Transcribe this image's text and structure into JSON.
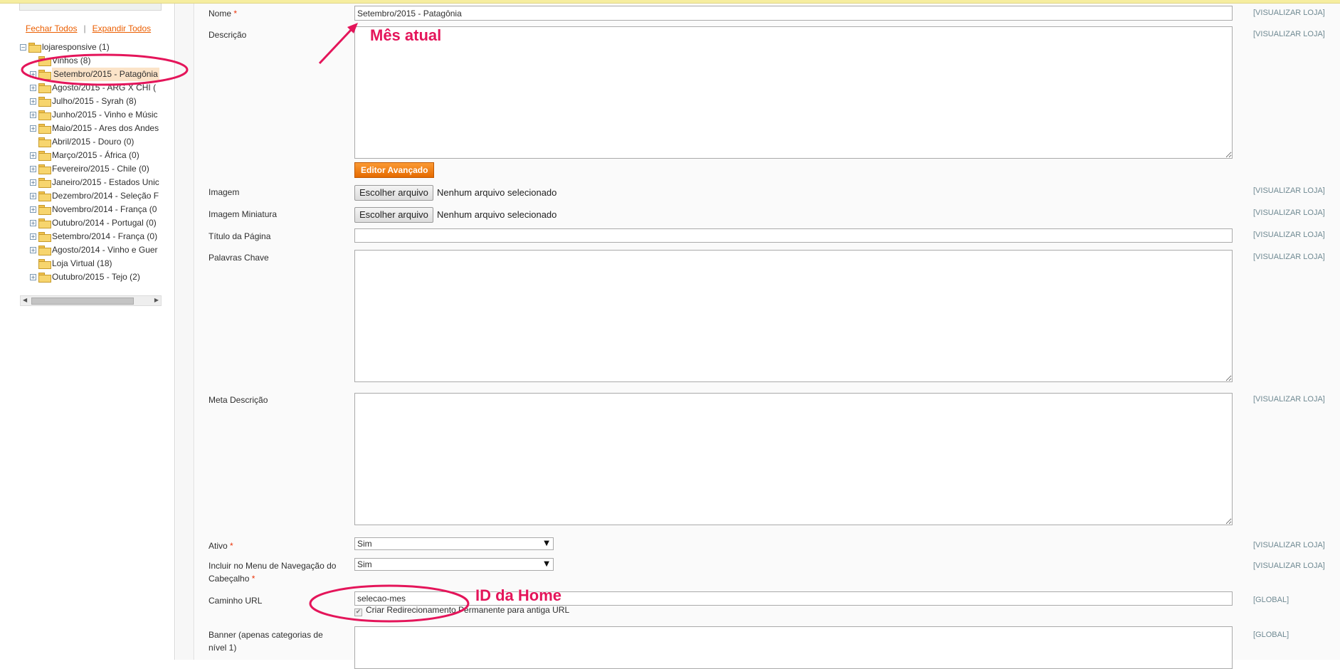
{
  "tree_links": {
    "collapse_all": "Fechar Todos",
    "separator": "|",
    "expand_all": "Expandir Todos"
  },
  "tree": [
    {
      "label": "lojaresponsive (1)",
      "level": 0,
      "toggle": "minus",
      "icon": "open-folder"
    },
    {
      "label": "Vinhos (8)",
      "level": 1,
      "toggle": "none",
      "icon": "folder"
    },
    {
      "label": "Setembro/2015 - Patagônia",
      "level": 1,
      "toggle": "plus",
      "icon": "folder",
      "selected": true
    },
    {
      "label": "Agosto/2015 - ARG X CHI (",
      "level": 1,
      "toggle": "plus",
      "icon": "folder"
    },
    {
      "label": "Julho/2015 - Syrah (8)",
      "level": 1,
      "toggle": "plus",
      "icon": "folder"
    },
    {
      "label": "Junho/2015 - Vinho e Músic",
      "level": 1,
      "toggle": "plus",
      "icon": "folder"
    },
    {
      "label": "Maio/2015 - Ares dos Andes",
      "level": 1,
      "toggle": "plus",
      "icon": "folder"
    },
    {
      "label": "Abril/2015 - Douro (0)",
      "level": 1,
      "toggle": "none",
      "icon": "folder"
    },
    {
      "label": "Março/2015 - África (0)",
      "level": 1,
      "toggle": "plus",
      "icon": "folder"
    },
    {
      "label": "Fevereiro/2015 - Chile (0)",
      "level": 1,
      "toggle": "plus",
      "icon": "folder"
    },
    {
      "label": "Janeiro/2015 - Estados Unic",
      "level": 1,
      "toggle": "plus",
      "icon": "folder"
    },
    {
      "label": "Dezembro/2014 - Seleção F",
      "level": 1,
      "toggle": "plus",
      "icon": "folder"
    },
    {
      "label": "Novembro/2014 - França (0",
      "level": 1,
      "toggle": "plus",
      "icon": "folder"
    },
    {
      "label": "Outubro/2014 - Portugal (0)",
      "level": 1,
      "toggle": "plus",
      "icon": "folder"
    },
    {
      "label": "Setembro/2014 - França (0)",
      "level": 1,
      "toggle": "plus",
      "icon": "folder"
    },
    {
      "label": "Agosto/2014 - Vinho e Guer",
      "level": 1,
      "toggle": "plus",
      "icon": "folder"
    },
    {
      "label": "Loja Virtual (18)",
      "level": 1,
      "toggle": "none",
      "icon": "folder"
    },
    {
      "label": "Outubro/2015 - Tejo (2)",
      "level": 1,
      "toggle": "plus",
      "icon": "folder"
    }
  ],
  "form": {
    "name": {
      "label": "Nome",
      "required": "*",
      "value": "Setembro/2015 - Patagônia",
      "scope": "[VISUALIZAR LOJA]"
    },
    "description": {
      "label": "Descrição",
      "value": "",
      "scope": "[VISUALIZAR LOJA]"
    },
    "editor_button": "Editor Avançado",
    "image": {
      "label": "Imagem",
      "button": "Escolher arquivo",
      "status": "Nenhum arquivo selecionado",
      "scope": "[VISUALIZAR LOJA]"
    },
    "thumbnail": {
      "label": "Imagem Miniatura",
      "button": "Escolher arquivo",
      "status": "Nenhum arquivo selecionado",
      "scope": "[VISUALIZAR LOJA]"
    },
    "page_title": {
      "label": "Título da Página",
      "value": "",
      "scope": "[VISUALIZAR LOJA]"
    },
    "keywords": {
      "label": "Palavras Chave",
      "value": "",
      "scope": "[VISUALIZAR LOJA]"
    },
    "meta_description": {
      "label": "Meta Descrição",
      "value": "",
      "scope": "[VISUALIZAR LOJA]"
    },
    "active": {
      "label": "Ativo",
      "required": "*",
      "value": "Sim",
      "scope": "[VISUALIZAR LOJA]"
    },
    "include_menu": {
      "label_line1": "Incluir no Menu de Navegação do",
      "label_line2": "Cabeçalho",
      "required": "*",
      "value": "Sim",
      "scope": "[VISUALIZAR LOJA]"
    },
    "url_key": {
      "label": "Caminho URL",
      "value": "selecao-mes",
      "scope": "[GLOBAL]"
    },
    "redirect_checkbox": {
      "label": "Criar Redirecionamento Permanente para antiga URL",
      "checked": true
    },
    "banner": {
      "label_line1": "Banner (apenas categorias de",
      "label_line2": "nível 1)",
      "scope": "[GLOBAL]"
    }
  },
  "annotations": {
    "current_month": "Mês atual",
    "home_id": "ID da Home",
    "color": "#e4155a"
  }
}
